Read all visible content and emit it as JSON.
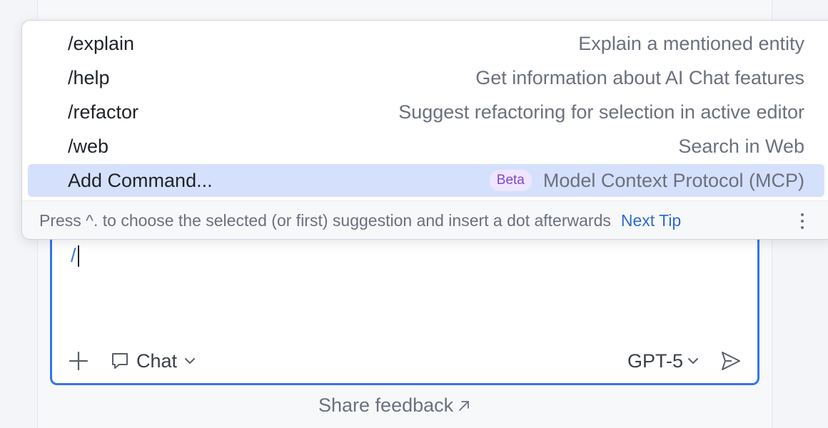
{
  "popup": {
    "commands": [
      {
        "name": "/explain",
        "description": "Explain a mentioned entity"
      },
      {
        "name": "/help",
        "description": "Get information about AI Chat features"
      },
      {
        "name": "/refactor",
        "description": "Suggest refactoring for selection in active editor"
      },
      {
        "name": "/web",
        "description": "Search in Web"
      }
    ],
    "add_command": {
      "name": "Add Command...",
      "badge": "Beta",
      "description": "Model Context Protocol (MCP)"
    },
    "footer": {
      "tip": "Press ^. to choose the selected (or first) suggestion and insert a dot afterwards",
      "next_tip": "Next Tip"
    }
  },
  "chat_input": {
    "value": "/",
    "mode_label": "Chat",
    "model_label": "GPT-5"
  },
  "share_feedback": "Share feedback",
  "colors": {
    "accent": "#3574f0",
    "selected_row": "#d5e1fc",
    "beta_text": "#7b48d2",
    "beta_bg": "#efe5ff",
    "link": "#2e6ad4"
  },
  "icons": {
    "plus": "plus-icon",
    "mode": "chat-bubble-icon",
    "chevron": "chevron-down-icon",
    "send": "send-icon",
    "more": "more-vertical-icon",
    "external": "arrow-up-right-icon"
  }
}
